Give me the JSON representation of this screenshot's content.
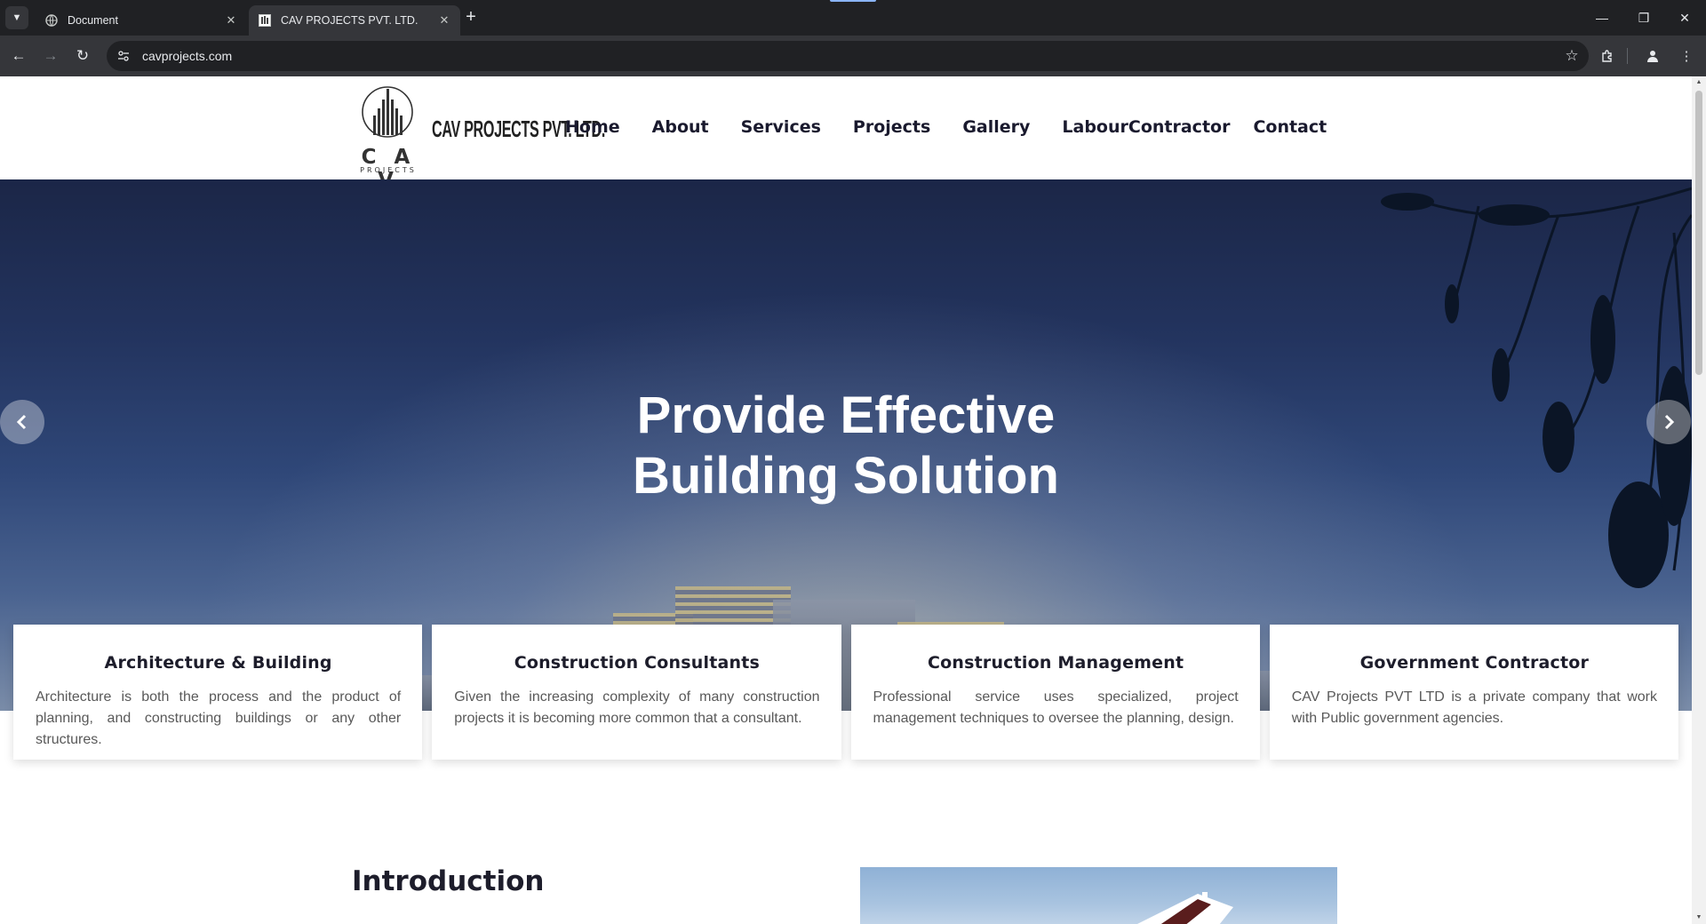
{
  "browser": {
    "tabs": [
      {
        "title": "Document",
        "active": false
      },
      {
        "title": "CAV PROJECTS PVT. LTD.",
        "active": true
      }
    ],
    "url": "cavprojects.com"
  },
  "site": {
    "logo_text": "C A V",
    "logo_subtext": "PROJECTS",
    "brand_name": "CAV PROJECTS PVT. LTD.",
    "nav": [
      "Home",
      "About",
      "Services",
      "Projects",
      "Gallery",
      "LabourContractor",
      "Contact"
    ]
  },
  "hero": {
    "title_line1": "Provide Effective",
    "title_line2": "Building Solution"
  },
  "services": [
    {
      "title": "Architecture & Building",
      "text": "Architecture is both the process and the product of planning, and constructing buildings or any other structures."
    },
    {
      "title": "Construction Consultants",
      "text": "Given the increasing complexity of many construction projects it is becoming more common that a consultant."
    },
    {
      "title": "Construction Management",
      "text": "Professional service uses specialized, project management techniques to oversee the planning, design."
    },
    {
      "title": "Government Contractor",
      "text": "CAV Projects PVT LTD is a private company that work with Public government agencies."
    }
  ],
  "intro": {
    "title": "Introduction"
  },
  "colors": {
    "chrome_dark": "#202124",
    "chrome_toolbar": "#35363a",
    "nav_text": "#1a1a2e",
    "hero_sky": "#23345f"
  }
}
